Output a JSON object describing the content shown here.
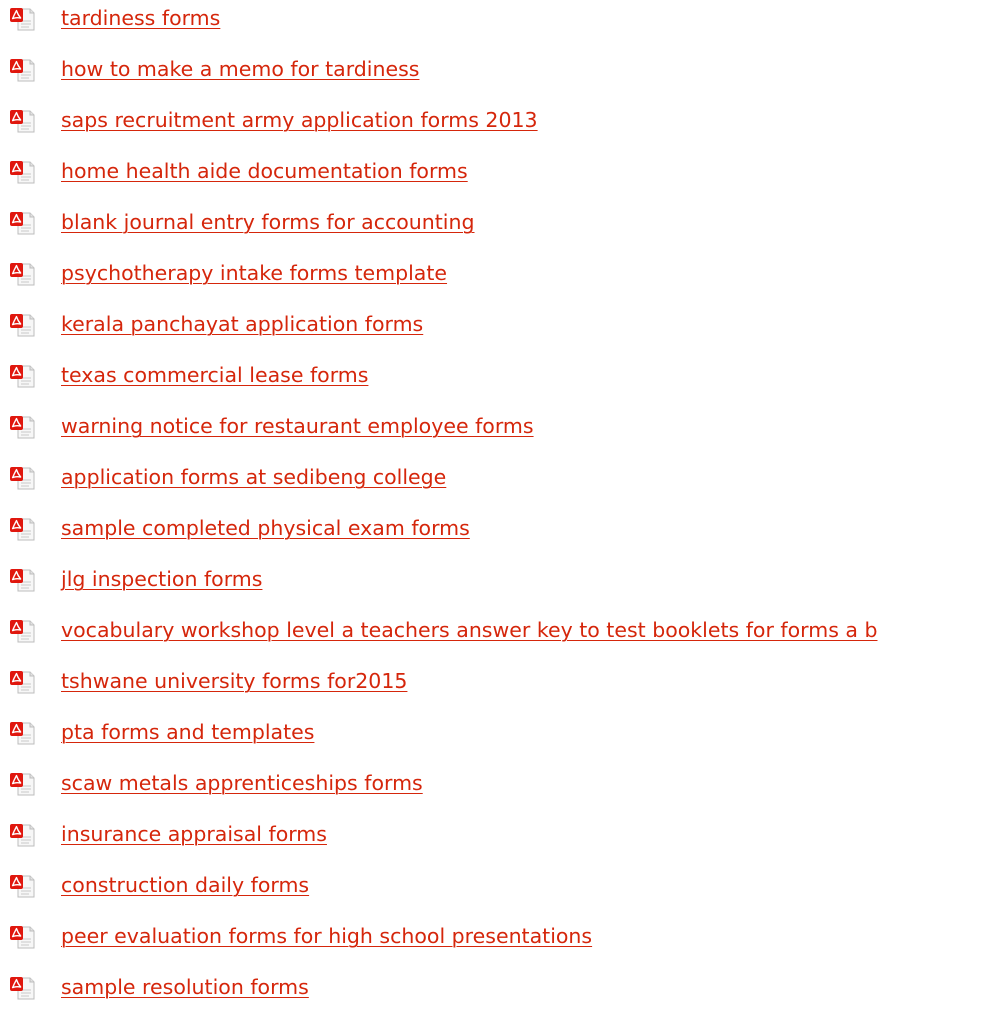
{
  "colors": {
    "link": "#d5260b",
    "icon_red": "#e0170e",
    "icon_gray": "#bcbcbc"
  },
  "icon_name": "pdf-file-icon",
  "documents": [
    {
      "label": "tardiness forms"
    },
    {
      "label": "how to make a memo for tardiness"
    },
    {
      "label": "saps recruitment army application forms 2013"
    },
    {
      "label": "home health aide documentation forms"
    },
    {
      "label": "blank journal entry forms for accounting"
    },
    {
      "label": "psychotherapy intake forms template"
    },
    {
      "label": "kerala panchayat application forms"
    },
    {
      "label": "texas commercial lease forms"
    },
    {
      "label": "warning notice for restaurant employee forms"
    },
    {
      "label": "application forms at sedibeng college"
    },
    {
      "label": "sample completed physical exam forms"
    },
    {
      "label": "jlg inspection forms"
    },
    {
      "label": "vocabulary workshop level a teachers answer key to test booklets for forms a b"
    },
    {
      "label": "tshwane university forms for2015"
    },
    {
      "label": "pta forms and templates"
    },
    {
      "label": "scaw metals apprenticeships forms"
    },
    {
      "label": "insurance appraisal forms"
    },
    {
      "label": "construction daily forms"
    },
    {
      "label": "peer evaluation forms for high school presentations"
    },
    {
      "label": "sample resolution forms"
    }
  ]
}
